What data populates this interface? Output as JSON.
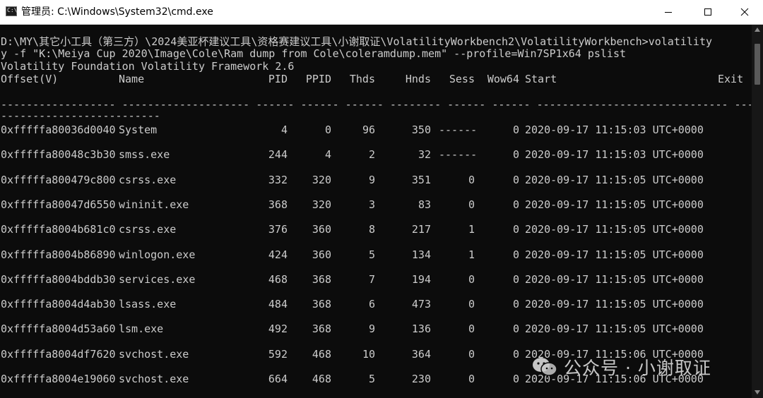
{
  "window": {
    "icon_label": "C:\\",
    "title": "管理员: C:\\Windows\\System32\\cmd.exe",
    "minimize_label": "minimize",
    "maximize_label": "maximize",
    "close_label": "close"
  },
  "console": {
    "command_line_1": "D:\\MY\\其它小工具（第三方）\\2024美亚杯建议工具\\资格赛建议工具\\小谢取证\\VolatilityWorkbench2\\VolatilityWorkbench>volatility",
    "command_line_2": "y -f \"K:\\Meiya Cup 2020\\Image\\Cole\\Ram dump from Cole\\coleramdump.mem\" --profile=Win7SP1x64 pslist",
    "banner": "Volatility Foundation Volatility Framework 2.6",
    "headers": {
      "offset": "Offset(V)",
      "name": "Name",
      "pid": "PID",
      "ppid": "PPID",
      "thds": "Thds",
      "hnds": "Hnds",
      "sess": "Sess",
      "wow64": "Wow64",
      "start": "Start",
      "exit": "Exit"
    },
    "separator_1": "------------------ -------------------- ------ ------ ------ -------- ------ ------ ------------------------------ -----",
    "separator_2": "-------------------------",
    "rows": [
      {
        "offset": "0xfffffa80036d0040",
        "name": "System",
        "pid": "4",
        "ppid": "0",
        "thds": "96",
        "hnds": "350",
        "sess": "------",
        "wow64": "0",
        "start": "2020-09-17 11:15:03 UTC+0000"
      },
      {
        "offset": "0xfffffa80048c3b30",
        "name": "smss.exe",
        "pid": "244",
        "ppid": "4",
        "thds": "2",
        "hnds": "32",
        "sess": "------",
        "wow64": "0",
        "start": "2020-09-17 11:15:03 UTC+0000"
      },
      {
        "offset": "0xfffffa800479c800",
        "name": "csrss.exe",
        "pid": "332",
        "ppid": "320",
        "thds": "9",
        "hnds": "351",
        "sess": "0",
        "wow64": "0",
        "start": "2020-09-17 11:15:05 UTC+0000"
      },
      {
        "offset": "0xfffffa80047d6550",
        "name": "wininit.exe",
        "pid": "368",
        "ppid": "320",
        "thds": "3",
        "hnds": "83",
        "sess": "0",
        "wow64": "0",
        "start": "2020-09-17 11:15:05 UTC+0000"
      },
      {
        "offset": "0xfffffa8004b681c0",
        "name": "csrss.exe",
        "pid": "376",
        "ppid": "360",
        "thds": "8",
        "hnds": "217",
        "sess": "1",
        "wow64": "0",
        "start": "2020-09-17 11:15:05 UTC+0000"
      },
      {
        "offset": "0xfffffa8004b86890",
        "name": "winlogon.exe",
        "pid": "424",
        "ppid": "360",
        "thds": "5",
        "hnds": "134",
        "sess": "1",
        "wow64": "0",
        "start": "2020-09-17 11:15:05 UTC+0000"
      },
      {
        "offset": "0xfffffa8004bddb30",
        "name": "services.exe",
        "pid": "468",
        "ppid": "368",
        "thds": "7",
        "hnds": "194",
        "sess": "0",
        "wow64": "0",
        "start": "2020-09-17 11:15:05 UTC+0000"
      },
      {
        "offset": "0xfffffa8004d4ab30",
        "name": "lsass.exe",
        "pid": "484",
        "ppid": "368",
        "thds": "6",
        "hnds": "473",
        "sess": "0",
        "wow64": "0",
        "start": "2020-09-17 11:15:05 UTC+0000"
      },
      {
        "offset": "0xfffffa8004d53a60",
        "name": "lsm.exe",
        "pid": "492",
        "ppid": "368",
        "thds": "9",
        "hnds": "136",
        "sess": "0",
        "wow64": "0",
        "start": "2020-09-17 11:15:05 UTC+0000"
      },
      {
        "offset": "0xfffffa8004df7620",
        "name": "svchost.exe",
        "pid": "592",
        "ppid": "468",
        "thds": "10",
        "hnds": "364",
        "sess": "0",
        "wow64": "0",
        "start": "2020-09-17 11:15:06 UTC+0000"
      },
      {
        "offset": "0xfffffa8004e19060",
        "name": "svchost.exe",
        "pid": "664",
        "ppid": "468",
        "thds": "5",
        "hnds": "230",
        "sess": "0",
        "wow64": "0",
        "start": "2020-09-17 11:15:06 UTC+0000"
      }
    ]
  },
  "watermark": {
    "text": "公众号 · 小谢取证",
    "icon": "wechat-icon"
  },
  "colors": {
    "console_bg": "#0c0c0c",
    "console_fg": "#cccccc",
    "titlebar_bg": "#ffffff"
  }
}
